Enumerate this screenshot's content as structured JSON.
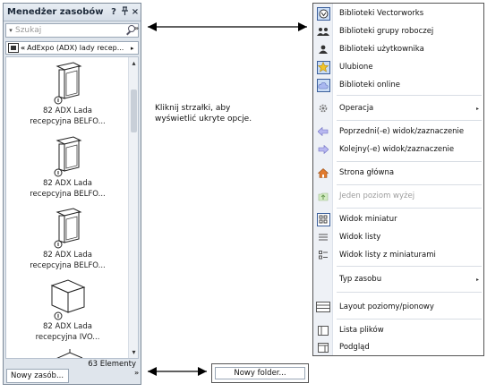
{
  "panel": {
    "title": "Menedżer zasobów",
    "btn_help": "?",
    "btn_pin": "ᵖ",
    "btn_close": "×",
    "overflow": "»",
    "search_placeholder": "Szukaj",
    "search_dropdown": "▾",
    "path_back": "«",
    "path_text": "AdExpo (ADX) lady recep...",
    "path_next": "▸",
    "items": [
      {
        "caption1": "82 ADX Lada",
        "caption2": "recepcyjna BELFO..."
      },
      {
        "caption1": "82 ADX Lada",
        "caption2": "recepcyjna BELFO..."
      },
      {
        "caption1": "82 ADX Lada",
        "caption2": "recepcyjna BELFO..."
      },
      {
        "caption1": "82 ADX Lada",
        "caption2": "recepcyjna IVO..."
      }
    ],
    "scroll_up": "▴",
    "scroll_down": "▾",
    "count": "63 Elementy",
    "new_resource": "Nowy zasób...",
    "bottom_overflow": "»"
  },
  "callout": {
    "line1": "Kliknij strzałki, aby",
    "line2": "wyświetlić ukryte opcje."
  },
  "new_folder": "Nowy folder...",
  "menu": {
    "items": [
      {
        "label": "Biblioteki Vectorworks",
        "icon": "vectorworks-icon"
      },
      {
        "label": "Biblioteki grupy roboczej",
        "icon": "workgroup-icon"
      },
      {
        "label": "Biblioteki użytkownika",
        "icon": "user-icon"
      },
      {
        "label": "Ulubione",
        "icon": "star-icon"
      },
      {
        "label": "Biblioteki online",
        "icon": "cloud-icon"
      },
      {
        "label": "Operacja",
        "icon": "gear-icon"
      },
      {
        "label": "Poprzedni(-e) widok/zaznaczenie",
        "icon": "arrow-left-icon"
      },
      {
        "label": "Kolejny(-e) widok/zaznaczenie",
        "icon": "arrow-right-icon"
      },
      {
        "label": "Strona główna",
        "icon": "home-icon"
      },
      {
        "label": "Jeden poziom wyżej",
        "icon": "folder-up-icon"
      },
      {
        "label": "Widok miniatur",
        "icon": "thumbnails-icon"
      },
      {
        "label": "Widok listy",
        "icon": "list-icon"
      },
      {
        "label": "Widok listy z miniaturami",
        "icon": "list-thumbs-icon"
      },
      {
        "label": "Typ zasobu",
        "icon": ""
      },
      {
        "label": "Layout poziomy/pionowy",
        "icon": "layout-icon"
      },
      {
        "label": "Lista plików",
        "icon": "file-list-icon"
      },
      {
        "label": "Podgląd",
        "icon": "preview-icon"
      }
    ],
    "submenu_marker": "▸"
  },
  "colors": {
    "accent": "#3b5f9c",
    "panel_bg": "#dfe5ec",
    "star": "#f2c42a",
    "home": "#e07a2e"
  }
}
